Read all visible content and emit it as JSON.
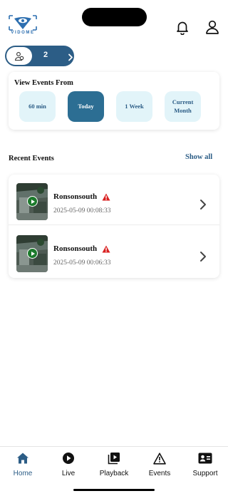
{
  "brand": {
    "logo_text": "VIDOME",
    "accent": "#2c5d86",
    "logo_color": "#2d6fb0"
  },
  "header": {
    "icons": [
      "bell-icon",
      "user-icon"
    ]
  },
  "site_selector": {
    "count": "2",
    "icon": "users-icon"
  },
  "filter": {
    "title": "View Events From",
    "options": [
      {
        "label": "60 min",
        "active": false
      },
      {
        "label": "Today",
        "active": true
      },
      {
        "label": "1 Week",
        "active": false
      },
      {
        "label": "Current Month",
        "active": false
      }
    ]
  },
  "recent": {
    "title": "Recent Events",
    "show_all": "Show all",
    "events": [
      {
        "name": "Ronsonsouth",
        "time": "2025-05-09 00:08:33",
        "alert_icon": "warning-icon"
      },
      {
        "name": "Ronsonsouth",
        "time": "2025-05-09 00:06:33",
        "alert_icon": "warning-icon"
      }
    ]
  },
  "tabs": [
    {
      "label": "Home",
      "icon": "home-icon",
      "active": true
    },
    {
      "label": "Live",
      "icon": "play-circle-icon",
      "active": false
    },
    {
      "label": "Playback",
      "icon": "playback-icon",
      "active": false
    },
    {
      "label": "Events",
      "icon": "warning-icon",
      "active": false
    },
    {
      "label": "Support",
      "icon": "support-card-icon",
      "active": false
    }
  ]
}
